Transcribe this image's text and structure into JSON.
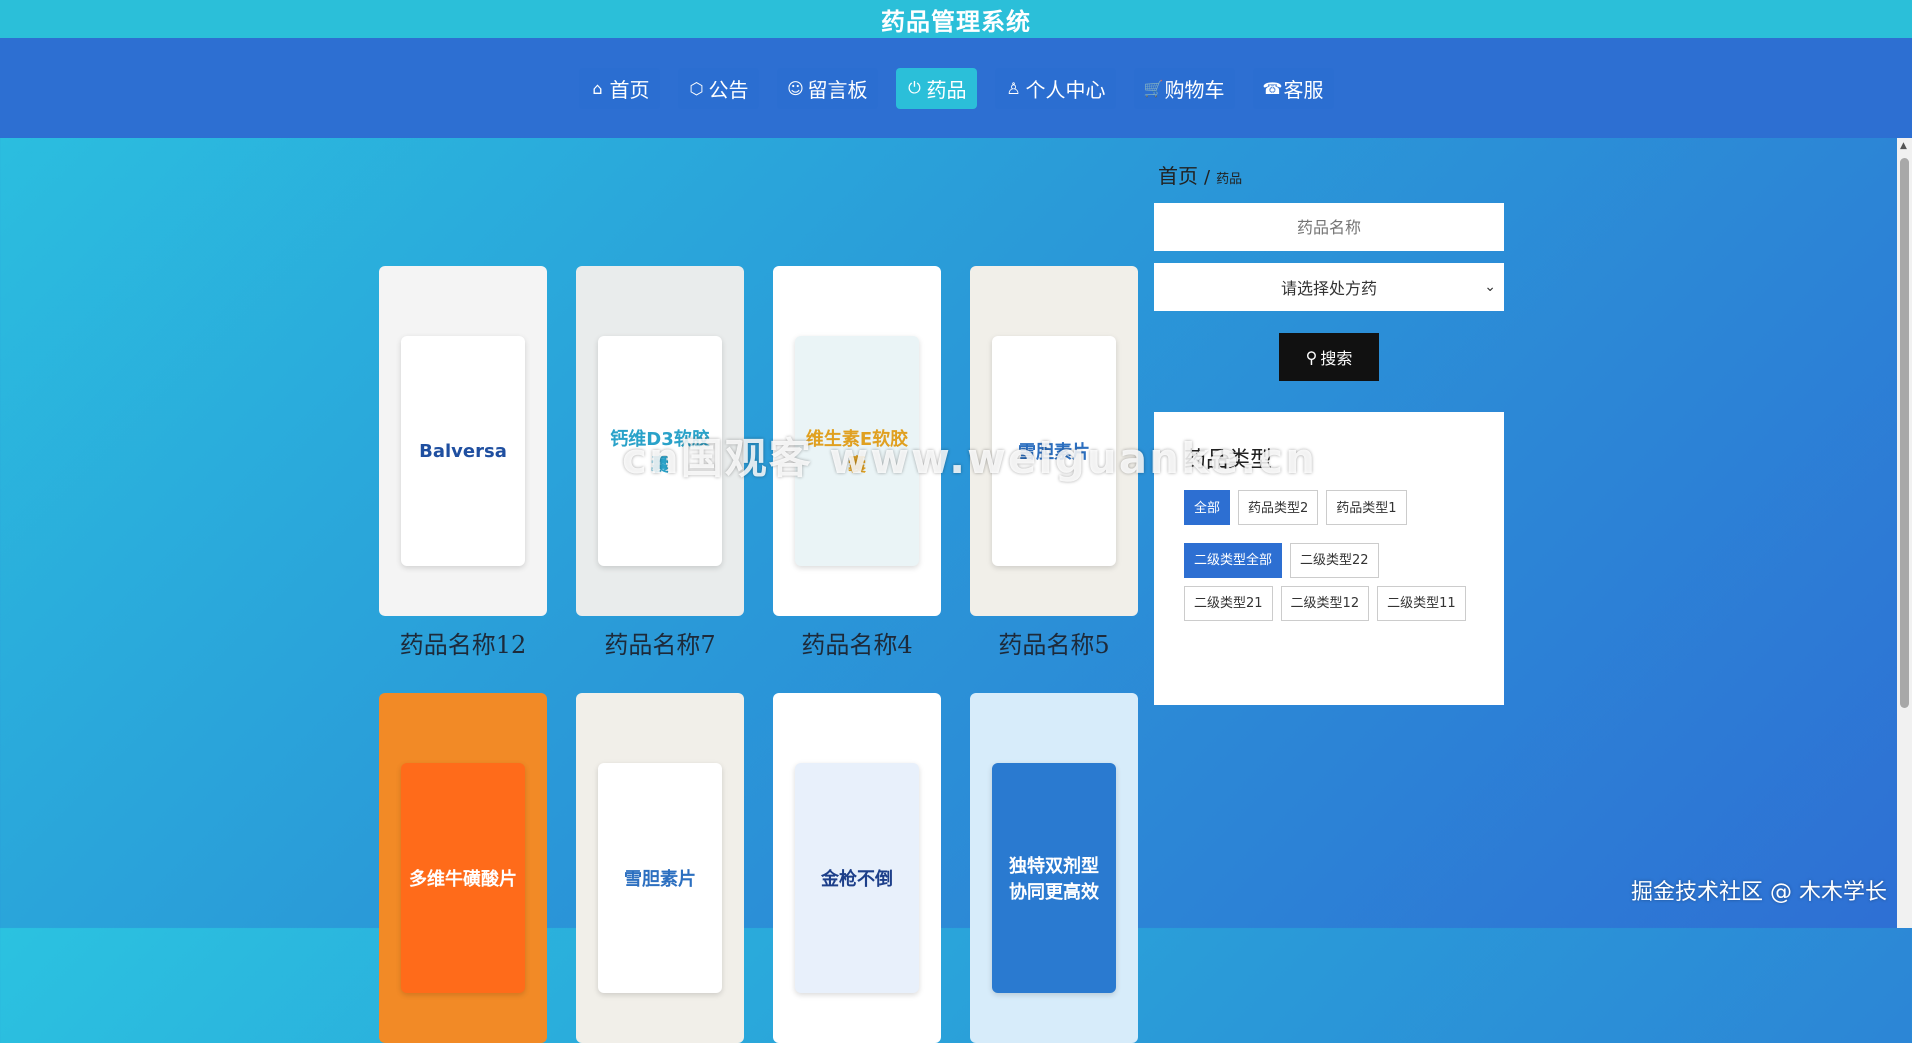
{
  "header": {
    "title": "药品管理系统"
  },
  "nav": {
    "items": [
      {
        "label": "首页",
        "icon": "home-icon",
        "glyph": "⌂"
      },
      {
        "label": "公告",
        "icon": "box-icon",
        "glyph": "⬡"
      },
      {
        "label": "留言板",
        "icon": "message-icon",
        "glyph": "☺"
      },
      {
        "label": "药品",
        "icon": "power-icon",
        "glyph": "⏻",
        "active": true
      },
      {
        "label": "个人中心",
        "icon": "user-icon",
        "glyph": "♙"
      },
      {
        "label": "购物车",
        "icon": "cart-icon",
        "glyph": "🛒"
      },
      {
        "label": "客服",
        "icon": "support-icon",
        "glyph": "☎"
      }
    ]
  },
  "breadcrumb": {
    "home": "首页",
    "separator": "/",
    "current": "药品"
  },
  "search": {
    "name_placeholder": "药品名称",
    "select_value": "请选择处方药",
    "button_label": "搜索"
  },
  "categories": {
    "title": "药品类型",
    "primary": [
      "全部",
      "药品类型2",
      "药品类型1"
    ],
    "secondary": [
      "二级类型全部",
      "二级类型22",
      "二级类型21",
      "二级类型12",
      "二级类型11"
    ]
  },
  "products": [
    {
      "name": "药品名称12",
      "pkg": "Balversa",
      "bg": "#f4f4f4",
      "pkg_bg": "#ffffff",
      "pkg_fg": "#1f4fa0"
    },
    {
      "name": "药品名称7",
      "pkg": "钙维D3软胶囊",
      "bg": "#e9ecec",
      "pkg_bg": "#ffffff",
      "pkg_fg": "#2aa2c9"
    },
    {
      "name": "药品名称4",
      "pkg": "维生素E软胶囊",
      "bg": "#ffffff",
      "pkg_bg": "#eaf4f6",
      "pkg_fg": "#e0a020"
    },
    {
      "name": "药品名称5",
      "pkg": "雪胆素片",
      "bg": "#f1efe9",
      "pkg_bg": "#ffffff",
      "pkg_fg": "#2c6fc0"
    },
    {
      "name": "",
      "pkg": "多维牛磺酸片",
      "bg": "#f28a26",
      "pkg_bg": "#ff6b1a",
      "pkg_fg": "#ffffff"
    },
    {
      "name": "",
      "pkg": "雪胆素片",
      "bg": "#f1efe9",
      "pkg_bg": "#ffffff",
      "pkg_fg": "#2c6fc0"
    },
    {
      "name": "",
      "pkg": "金枪不倒",
      "bg": "#ffffff",
      "pkg_bg": "#e8f0fb",
      "pkg_fg": "#1d3f8a"
    },
    {
      "name": "",
      "pkg": "独特双剂型 协同更高效",
      "bg": "#d7ecfa",
      "pkg_bg": "#2a7ad0",
      "pkg_fg": "#ffffff"
    }
  ],
  "watermark": "cn国观客 www.weiguanke.cn",
  "footer_mark": "掘金技术社区 @ 木木学长"
}
